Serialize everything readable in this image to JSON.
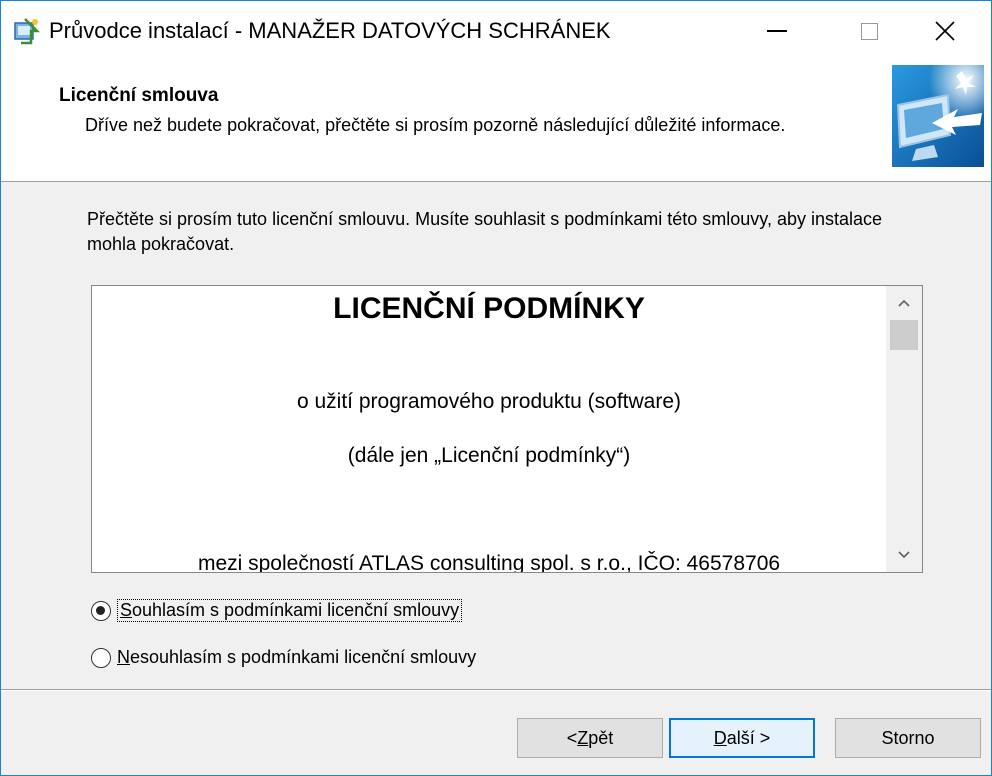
{
  "window": {
    "title": "Průvodce instalací - MANAŽER DATOVÝCH SCHRÁNEK",
    "controls": {
      "minimize": "minimize",
      "maximize": "maximize",
      "close": "close"
    }
  },
  "header": {
    "title": "Licenční smlouva",
    "subtitle": "Dříve než budete pokračovat, přečtěte si prosím pozorně následující důležité informace."
  },
  "main": {
    "intro": "Přečtěte si prosím tuto licenční smlouvu. Musíte souhlasit s podmínkami této smlouvy, aby instalace mohla pokračovat.",
    "license": {
      "heading": "LICENČNÍ PODMÍNKY",
      "line1": "o užití programového produktu (software)",
      "line2": "(dále jen „Licenční podmínky“)",
      "line3": "mezi společností ATLAS consulting spol. s r.o., IČO: 46578706"
    },
    "radios": [
      {
        "key": "S",
        "rest": "ouhlasím s podmínkami licenční smlouvy",
        "selected": true
      },
      {
        "key": "N",
        "rest": "esouhlasím s podmínkami licenční smlouvy",
        "selected": false
      }
    ]
  },
  "footer": {
    "back": {
      "prefix": "< ",
      "key": "Z",
      "rest": "pět"
    },
    "next": {
      "key": "D",
      "rest": "alší >"
    },
    "cancel": "Storno"
  },
  "colors": {
    "accent": "#0078d7",
    "window_border": "#1883d7"
  }
}
